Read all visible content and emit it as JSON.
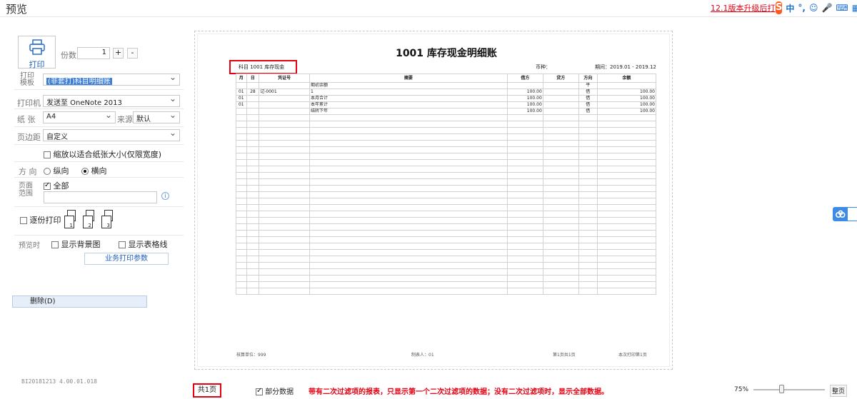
{
  "window": {
    "title": "预览"
  },
  "upgrade_link": "12.1版本升级后打",
  "ime": {
    "logo": "S",
    "items": [
      "中",
      "°,",
      "☺",
      "🎤",
      "⌨",
      "▦"
    ]
  },
  "left_panel": {
    "print_button": "打印",
    "copies_label": "份数",
    "copies_value": "1",
    "plus": "+",
    "minus": "-",
    "template_label": "打印模板",
    "template_value": "(非套打)科目明细账",
    "printer_label": "打印机",
    "printer_value": "发送至 OneNote 2013",
    "paper_label": "纸  张",
    "paper_value": "A4",
    "source_label": "来源",
    "source_value": "默认",
    "margin_label": "页边距",
    "margin_value": "自定义",
    "fit_width_label": "缩放以适合纸张大小(仅限宽度)",
    "orientation_label": "方  向",
    "portrait": "纵向",
    "landscape": "横向",
    "range_label": "页面范围",
    "all_label": "全部",
    "collate_label": "逐份打印",
    "collate_pages": [
      "1",
      "2",
      "3"
    ],
    "preview_label": "预览时",
    "show_bg": "显示背景图",
    "show_grid": "显示表格线",
    "business_params": "业务打印参数",
    "delete_button": "删除(D)",
    "version": "BI20181213 4.00.01.018"
  },
  "preview": {
    "doc_title": "1001 库存现金明细账",
    "subject": "科目  1001 库存现金",
    "currency_label": "币种：",
    "period": "期间：2019.01 - 2019.12",
    "columns": [
      "月",
      "日",
      "凭证号",
      "摘要",
      "借方",
      "贷方",
      "方向",
      "余额"
    ],
    "rows": [
      [
        "",
        "",
        "",
        "期初余额",
        "",
        "",
        "平",
        ""
      ],
      [
        "01",
        "28",
        "记-0001",
        "1",
        "100.00",
        "",
        "借",
        "100.00"
      ],
      [
        "01",
        "",
        "",
        "本月合计",
        "100.00",
        "",
        "借",
        "100.00"
      ],
      [
        "01",
        "",
        "",
        "本年累计",
        "100.00",
        "",
        "借",
        "100.00"
      ],
      [
        "",
        "",
        "",
        "结转下年",
        "100.00",
        "",
        "借",
        "100.00"
      ]
    ],
    "empty_rows": 28,
    "footer_unit": "核算单位：999",
    "footer_maker": "制表人：01",
    "footer_page": "第1页共1页",
    "footer_printcount": "本次打印第1页"
  },
  "bottom": {
    "pages_total": "共1页",
    "partial_data": "部分数据",
    "notice": "带有二次过滤项的报表，只显示第一个二次过滤项的数据；没有二次过滤项时，显示全部数据。",
    "zoom": "75%",
    "fit": "整页"
  }
}
